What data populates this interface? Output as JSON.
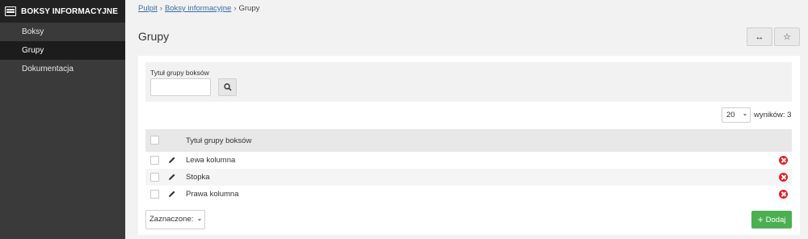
{
  "sidebar": {
    "title": "BOKSY INFORMACYJNE",
    "items": [
      {
        "label": "Boksy",
        "active": false
      },
      {
        "label": "Grupy",
        "active": true
      },
      {
        "label": "Dokumentacja",
        "active": false
      }
    ]
  },
  "breadcrumb": {
    "items": [
      "Pulpit",
      "Boksy informacyjne",
      "Grupy"
    ],
    "separator": "›"
  },
  "page": {
    "title": "Grupy",
    "expand_icon": "↔",
    "favorite_icon": "☆"
  },
  "filter": {
    "label": "Tytuł grupy boksów",
    "value": ""
  },
  "pagination": {
    "per_page": "20",
    "results": "wyników: 3"
  },
  "table": {
    "header": "Tytuł grupy boksów",
    "rows": [
      "Lewa kolumna",
      "Stopka",
      "Prawa kolumna"
    ]
  },
  "footer": {
    "bulk_label": "Zaznaczone:",
    "add_label": "Dodaj",
    "add_icon": "+"
  },
  "colors": {
    "sidebar_bg": "#3a3a3a",
    "sidebar_header_bg": "#222222",
    "link": "#3a6ea5",
    "add_button": "#4caf50",
    "delete_icon": "#d9232a"
  }
}
